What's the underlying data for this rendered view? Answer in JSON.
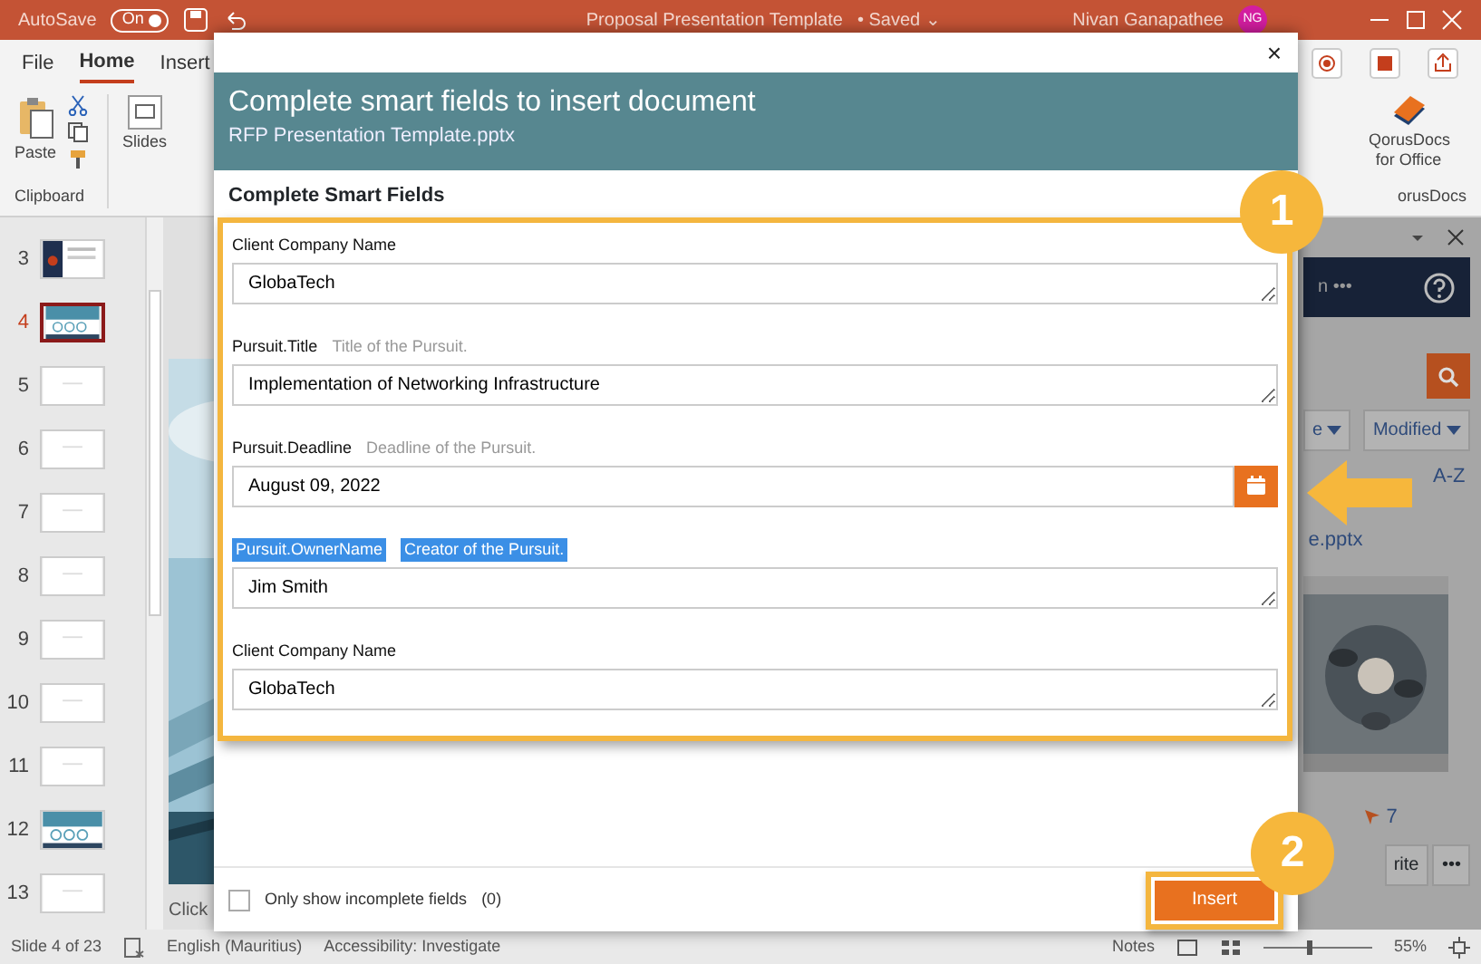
{
  "title_bar": {
    "autosave": "AutoSave",
    "autosave_switch": {
      "label": "On",
      "on": true
    },
    "title": "Proposal Presentation Template",
    "saved": "• Saved ⌄",
    "user": "Nivan Ganapathee",
    "initials": "NG"
  },
  "ribbon": {
    "tabs": [
      {
        "label": "File",
        "selected": false
      },
      {
        "label": "Home",
        "selected": true
      },
      {
        "label": "Insert",
        "selected": false
      }
    ],
    "paste": "Paste",
    "slides": "Slides",
    "clipboard": "Clipboard",
    "addin": "QorusDocs for Office",
    "addin_group": "orusDocs"
  },
  "slides": [
    {
      "number": "3",
      "selected": false,
      "kind": "cover"
    },
    {
      "number": "4",
      "selected": true
    },
    {
      "number": "5",
      "selected": false,
      "kind": "blank"
    },
    {
      "number": "6",
      "selected": false,
      "kind": "blank"
    },
    {
      "number": "7",
      "selected": false,
      "kind": "blank"
    },
    {
      "number": "8",
      "selected": false,
      "kind": "blank"
    },
    {
      "number": "9",
      "selected": false,
      "kind": "blank"
    },
    {
      "number": "10",
      "selected": false,
      "kind": "blank"
    },
    {
      "number": "11",
      "selected": false,
      "kind": "blank"
    },
    {
      "number": "12",
      "selected": false
    },
    {
      "number": "13",
      "selected": false,
      "kind": "blank"
    }
  ],
  "notes_area": {
    "text": "Click"
  },
  "task_pane": {
    "tab_partial": "n",
    "tab_more": "•••",
    "filter_partial": "e",
    "sort": "Modified",
    "order": "A-Z",
    "file": "e.pptx",
    "count": "7",
    "action": "rite",
    "more": "•••"
  },
  "dialog": {
    "close": "×",
    "title": "Complete smart fields to insert document",
    "subtitle": "RFP Presentation Template.pptx",
    "section": "Complete Smart Fields",
    "fields": [
      {
        "kind": "text",
        "label": "Client Company Name",
        "value": "GlobaTech",
        "highlighted": false
      },
      {
        "kind": "text",
        "label": "Pursuit.Title",
        "hint": "Title of the Pursuit.",
        "value": "Implementation of Networking Infrastructure",
        "highlighted": false
      },
      {
        "kind": "date",
        "label": "Pursuit.Deadline",
        "hint": "Deadline of the Pursuit.",
        "value": "August 09, 2022",
        "highlighted": false
      },
      {
        "kind": "text",
        "label": "Pursuit.OwnerName",
        "hint": "Creator of the Pursuit.",
        "value": "Jim Smith",
        "highlighted": true
      },
      {
        "kind": "text",
        "label": "Client Company Name",
        "value": "GlobaTech",
        "highlighted": false
      }
    ],
    "filter": {
      "label": "Only show incomplete fields",
      "count": "(0)",
      "checked": false
    },
    "insert": "Insert"
  },
  "callouts": [
    {
      "number": "1"
    },
    {
      "number": "2"
    }
  ],
  "status_bar": {
    "slide": "Slide 4 of 23",
    "language": "English (Mauritius)",
    "accessibility": "Accessibility: Investigate",
    "notes": "Notes",
    "zoom": "55%"
  }
}
